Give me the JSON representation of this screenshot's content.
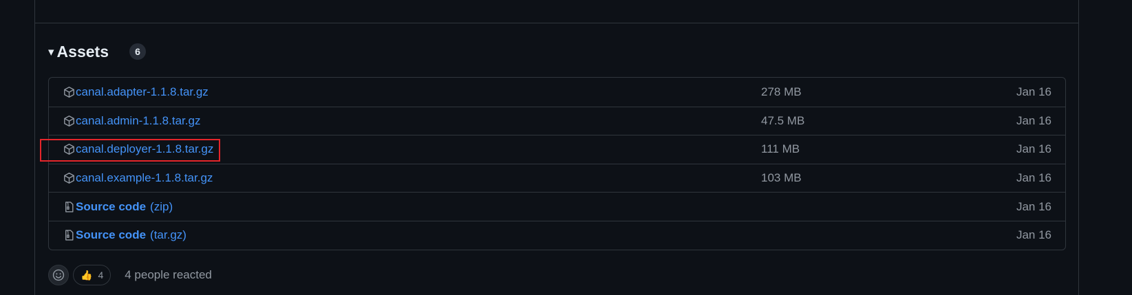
{
  "assets": {
    "title": "Assets",
    "count": "6",
    "items": [
      {
        "name": "canal.adapter-1.1.8.tar.gz",
        "size": "278 MB",
        "date": "Jan 16",
        "icon": "package-icon"
      },
      {
        "name": "canal.admin-1.1.8.tar.gz",
        "size": "47.5 MB",
        "date": "Jan 16",
        "icon": "package-icon"
      },
      {
        "name": "canal.deployer-1.1.8.tar.gz",
        "size": "111 MB",
        "date": "Jan 16",
        "icon": "package-icon"
      },
      {
        "name": "canal.example-1.1.8.tar.gz",
        "size": "103 MB",
        "date": "Jan 16",
        "icon": "package-icon"
      },
      {
        "name": "Source code",
        "ext": "(zip)",
        "size": "",
        "date": "Jan 16",
        "icon": "file-zip-icon"
      },
      {
        "name": "Source code",
        "ext": "(tar.gz)",
        "size": "",
        "date": "Jan 16",
        "icon": "file-zip-icon"
      }
    ]
  },
  "reactions": {
    "emoji": "👍",
    "count": "4",
    "summary": "4 people reacted"
  },
  "colors": {
    "background": "#0d1117",
    "border": "#30363d",
    "link": "#4493f8",
    "muted": "#9198a1",
    "highlight": "#e5252a"
  }
}
